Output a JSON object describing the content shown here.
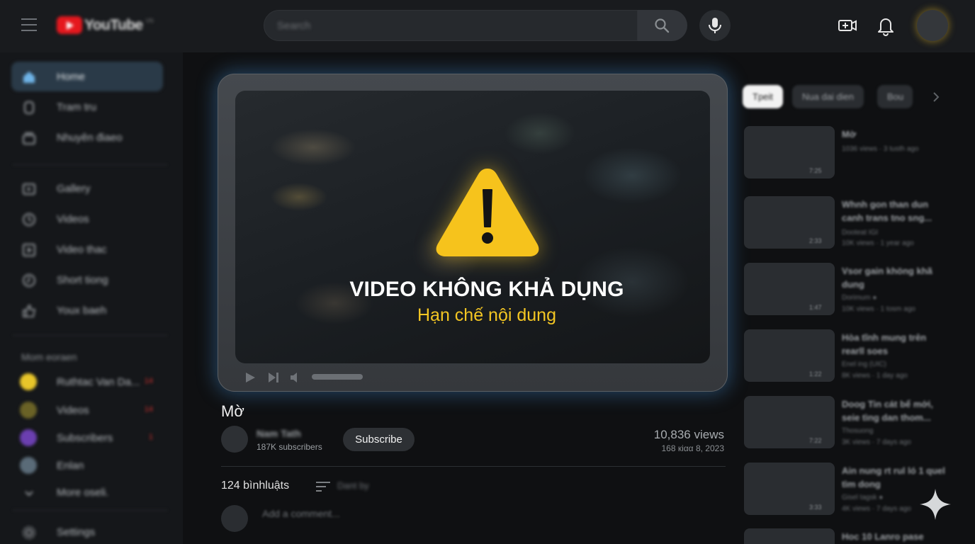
{
  "header": {
    "logo_text": "YouTube",
    "logo_region": "VN",
    "search_placeholder": "Search"
  },
  "sidebar": {
    "items": [
      {
        "label": "Home"
      },
      {
        "label": "Tram tru"
      },
      {
        "label": "Nhuyên điaeo"
      },
      {
        "label": "Gallery"
      },
      {
        "label": "Videos"
      },
      {
        "label": "Video thac"
      },
      {
        "label": "Short tiong"
      },
      {
        "label": "Youx baeh"
      }
    ],
    "section_heading": "Mom eoraen",
    "channels": [
      {
        "label": "Ruthtac Van Da...",
        "badge": "14",
        "color": "#e8c62a"
      },
      {
        "label": "Videos",
        "badge": "14",
        "color": "#6a6226"
      },
      {
        "label": "Subscribers",
        "badge": "1",
        "color": "#6b3fb0"
      },
      {
        "label": "Enlan",
        "badge": "",
        "color": "#5a6b78"
      }
    ],
    "more_label": "More oseli.",
    "settings_label": "Settings"
  },
  "player": {
    "title": "VIDEO KHÔNG KHẢ DỤNG",
    "subtitle": "Hạn chế nội dung"
  },
  "video": {
    "name": "Mờ",
    "channel_name": "Nam Tath",
    "subscribers": "187K subscribers",
    "subscribe_label": "Subscribe",
    "views": "10,836 views",
    "date": "168 кіαα 8, 2023"
  },
  "comments": {
    "count": "124 bìnhluậts",
    "sort_label": "Dant by",
    "placeholder": "Add a comment..."
  },
  "right": {
    "chips": [
      "Tpeit",
      "Nua dai dien",
      "Bou"
    ],
    "recommendations": [
      {
        "title": "Mờ",
        "meta": [
          "1036 views · 3 tusth ago"
        ],
        "duration": "7:25"
      },
      {
        "title": "Whnh gon than dun canh trans tno sng...",
        "meta": [
          "Dooteat IGI",
          "10K views · 1 year ago"
        ],
        "duration": "2:33"
      },
      {
        "title": "Vsor gain khöng khã dung",
        "meta": [
          "Dorimum ●",
          "10K views · 1 tosm ago"
        ],
        "duration": "1:47"
      },
      {
        "title": "Hòa tĩnh mung trên rearll soes",
        "meta": [
          "Enel ing (UIC)",
          "8K views · 1 day ago"
        ],
        "duration": "1:22"
      },
      {
        "title": "Doog Tin cát bể mới, seie tìng dan thom...",
        "meta": [
          "Thosuong",
          "3K views · 7 days ago"
        ],
        "duration": "7:22"
      },
      {
        "title": "Ain nung rt rul ló 1 quel tìm dong",
        "meta": [
          "Gisel tagsk ●",
          "4K views · 7 days ago"
        ],
        "duration": "3:33"
      },
      {
        "title": "Hoc 10 Lanro pase",
        "meta": [],
        "duration": ""
      }
    ]
  }
}
